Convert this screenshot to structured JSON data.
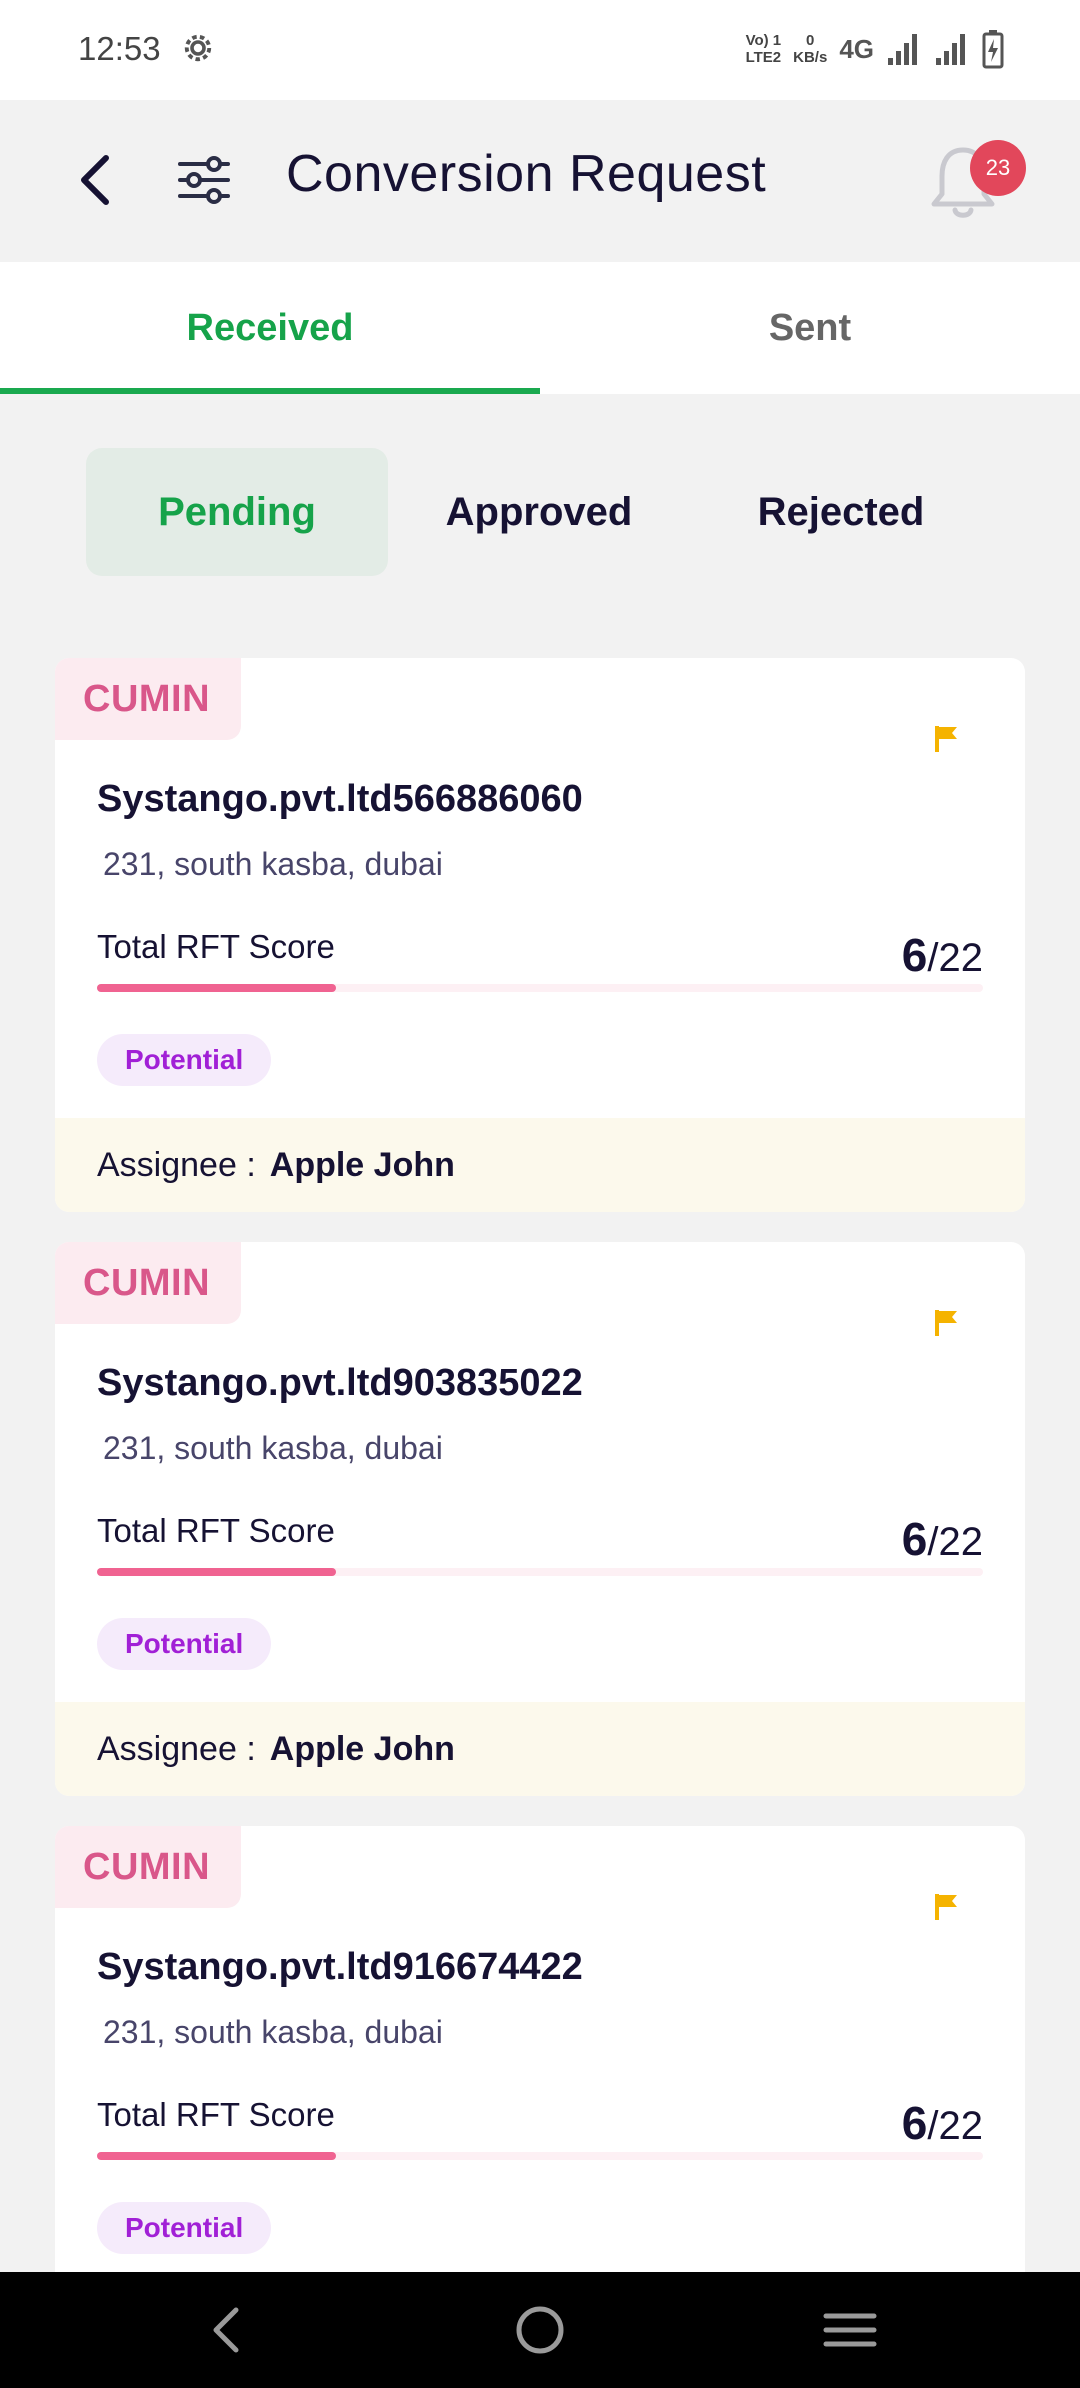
{
  "status_bar": {
    "time": "12:53",
    "net_volte": "Vo) 1",
    "net_lte": "LTE2",
    "net_speed_value": "0",
    "net_speed_unit": "KB/s",
    "net_type": "4G",
    "icons": [
      "gear-icon",
      "signal-icon",
      "signal-icon",
      "battery-charging-icon"
    ]
  },
  "header": {
    "title": "Conversion Request",
    "back_icon": "chevron-left-icon",
    "filter_icon": "sliders-icon",
    "bell_icon": "bell-icon",
    "notification_count": "23"
  },
  "main_tabs": [
    {
      "label": "Received",
      "active": true
    },
    {
      "label": "Sent",
      "active": false
    }
  ],
  "sub_tabs": [
    {
      "label": "Pending",
      "active": true
    },
    {
      "label": "Approved",
      "active": false
    },
    {
      "label": "Rejected",
      "active": false
    }
  ],
  "colors": {
    "accent_green": "#16a34a",
    "crop_tag_pink": "#d9578a",
    "score_bar_pink": "#f06391",
    "potential_purple": "#a120d6",
    "flag_yellow": "#f5b300",
    "badge_red": "#e2475b"
  },
  "cards": [
    {
      "crop": "CUMIN",
      "company": "Systango.pvt.ltd566886060",
      "address": "231, south kasba, dubai",
      "rft_label": "Total RFT Score",
      "rft_score": "6",
      "rft_max": "/22",
      "rft_fraction": 0.27,
      "status": "Potential",
      "assignee_label": "Assignee :",
      "assignee": "Apple John"
    },
    {
      "crop": "CUMIN",
      "company": "Systango.pvt.ltd903835022",
      "address": "231, south kasba, dubai",
      "rft_label": "Total RFT Score",
      "rft_score": "6",
      "rft_max": "/22",
      "rft_fraction": 0.27,
      "status": "Potential",
      "assignee_label": "Assignee :",
      "assignee": "Apple John"
    },
    {
      "crop": "CUMIN",
      "company": "Systango.pvt.ltd916674422",
      "address": "231, south kasba, dubai",
      "rft_label": "Total RFT Score",
      "rft_score": "6",
      "rft_max": "/22",
      "rft_fraction": 0.27,
      "status": "Potential"
    }
  ],
  "nav_bar": {
    "buttons": [
      "back-nav-icon",
      "home-nav-icon",
      "recents-nav-icon"
    ]
  }
}
